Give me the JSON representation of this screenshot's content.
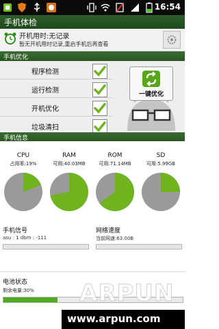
{
  "status_bar": {
    "time": "16:54"
  },
  "title_bar": {
    "title": "手机体检"
  },
  "usage": {
    "line1": "开机用时:无记录",
    "line2": "暂无开机用时记录,重启手机后再查看"
  },
  "sections": {
    "optimize": "手机优化",
    "info": "手机信息"
  },
  "optimize_items": [
    {
      "label": "程序检测",
      "checked": true
    },
    {
      "label": "运行检测",
      "checked": true
    },
    {
      "label": "开机优化",
      "checked": true
    },
    {
      "label": "垃圾清扫",
      "checked": true
    }
  ],
  "onekey": {
    "label": "一键优化"
  },
  "resources": [
    {
      "title": "CPU",
      "sub": "占用率:19%",
      "used_fraction": 0.19
    },
    {
      "title": "RAM",
      "sub": "可用:40.03MB",
      "used_fraction": 0.72
    },
    {
      "title": "ROM",
      "sub": "可用:71.14MB",
      "used_fraction": 0.65
    },
    {
      "title": "SD",
      "sub": "可用:5.99GB",
      "used_fraction": 0.25
    }
  ],
  "signal": {
    "title": "手机信号",
    "value": "asu : 1 dbm : -111"
  },
  "network": {
    "title": "网络速度",
    "value": "当前网速:63.00B"
  },
  "battery": {
    "title": "电池状态",
    "value": "剩余电量:30%",
    "level": 0.3
  },
  "watermark": {
    "brand": "ARPUN",
    "url": "www.arpun.com"
  },
  "colors": {
    "green": "#6fb31e",
    "gray_pie": "#9a9a9a"
  }
}
